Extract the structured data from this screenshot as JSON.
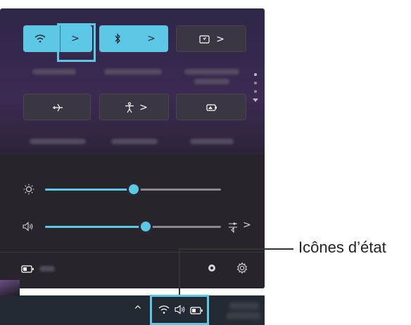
{
  "quick_settings": {
    "tiles_row1": [
      {
        "name": "wifi",
        "active": true,
        "icon": "wifi-icon",
        "chevron": ">"
      },
      {
        "name": "bluetooth",
        "active": true,
        "icon": "bluetooth-icon",
        "chevron": ">"
      },
      {
        "name": "cast",
        "active": false,
        "icon": "cast-icon",
        "chevron": ">"
      }
    ],
    "tiles_row2": [
      {
        "name": "airplane",
        "active": false,
        "icon": "airplane-icon"
      },
      {
        "name": "accessibility",
        "active": false,
        "icon": "accessibility-icon",
        "chevron": ">"
      },
      {
        "name": "energy",
        "active": false,
        "icon": "battery-saver-icon"
      }
    ],
    "brightness": {
      "icon": "sun-icon",
      "level": 0.48
    },
    "volume": {
      "icon": "speaker-icon",
      "level": 0.57,
      "output_chevron": ">"
    }
  },
  "footer": {
    "battery_icon": "battery-icon",
    "settings_icon": "gear-icon"
  },
  "taskbar": {
    "tray_chevron": "^"
  },
  "callout": {
    "text": "Icônes d’état"
  },
  "colors": {
    "accent": "#5cc8e6",
    "panel": "#2a2335",
    "taskbar": "#242a33"
  }
}
